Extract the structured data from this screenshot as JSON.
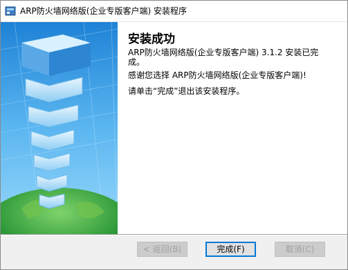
{
  "window": {
    "title": "ARP防火墙网络版(企业专版客户端) 安装程序",
    "icon": "installer-icon"
  },
  "main": {
    "heading": "安装成功",
    "message_line1": "ARP防火墙网络版(企业专版客户端) 3.1.2 安装已完",
    "message_line1_cont": "成。",
    "message_thanks": "感谢您选择 ARP防火墙网络版(企业专版客户端)!",
    "message_instruction": "请单击“完成”退出该安装程序。"
  },
  "buttons": {
    "back": "< 返回(B)",
    "finish": "完成(F)",
    "cancel": "取消(C)"
  },
  "colors": {
    "accent": "#0078d7",
    "banner_sky": "#3a9be0",
    "banner_tower": "#7ec8f5"
  }
}
